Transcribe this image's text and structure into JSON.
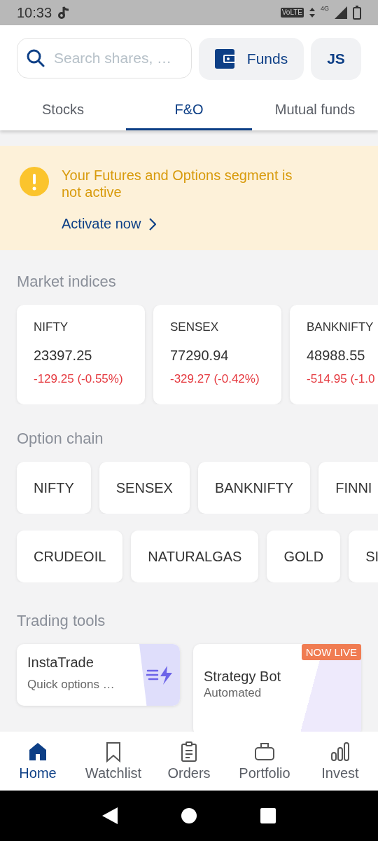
{
  "status_bar": {
    "time": "10:33",
    "volte": "VoLTE",
    "network": "4G"
  },
  "header": {
    "search": {
      "placeholder": "Search shares, …"
    },
    "funds_button": "Funds",
    "avatar": "JS"
  },
  "tabs": [
    {
      "label": "Stocks",
      "selected": false
    },
    {
      "label": "F&O",
      "selected": true
    },
    {
      "label": "Mutual funds",
      "selected": false
    }
  ],
  "banner": {
    "message": "Your Futures and Options segment is not active",
    "action": "Activate now"
  },
  "market_indices": {
    "title": "Market indices",
    "items": [
      {
        "name": "NIFTY",
        "value": "23397.25",
        "change": "-129.25 (-0.55%)"
      },
      {
        "name": "SENSEX",
        "value": "77290.94",
        "change": "-329.27 (-0.42%)"
      },
      {
        "name": "BANKNIFTY",
        "value": "48988.55",
        "change": "-514.95 (-1.0"
      }
    ]
  },
  "option_chain": {
    "title": "Option chain",
    "rows": [
      [
        "NIFTY",
        "SENSEX",
        "BANKNIFTY",
        "FINNI"
      ],
      [
        "CRUDEOIL",
        "NATURALGAS",
        "GOLD",
        "SI"
      ]
    ]
  },
  "trading_tools": {
    "title": "Trading tools",
    "items": [
      {
        "name": "InstaTrade",
        "subtitle": "Quick options …"
      },
      {
        "name": "Strategy Bot",
        "subtitle": "Automated",
        "badge": "NOW LIVE"
      }
    ]
  },
  "bottom_nav": [
    {
      "label": "Home",
      "selected": true
    },
    {
      "label": "Watchlist",
      "selected": false
    },
    {
      "label": "Orders",
      "selected": false
    },
    {
      "label": "Portfolio",
      "selected": false
    },
    {
      "label": "Invest",
      "selected": false
    }
  ]
}
